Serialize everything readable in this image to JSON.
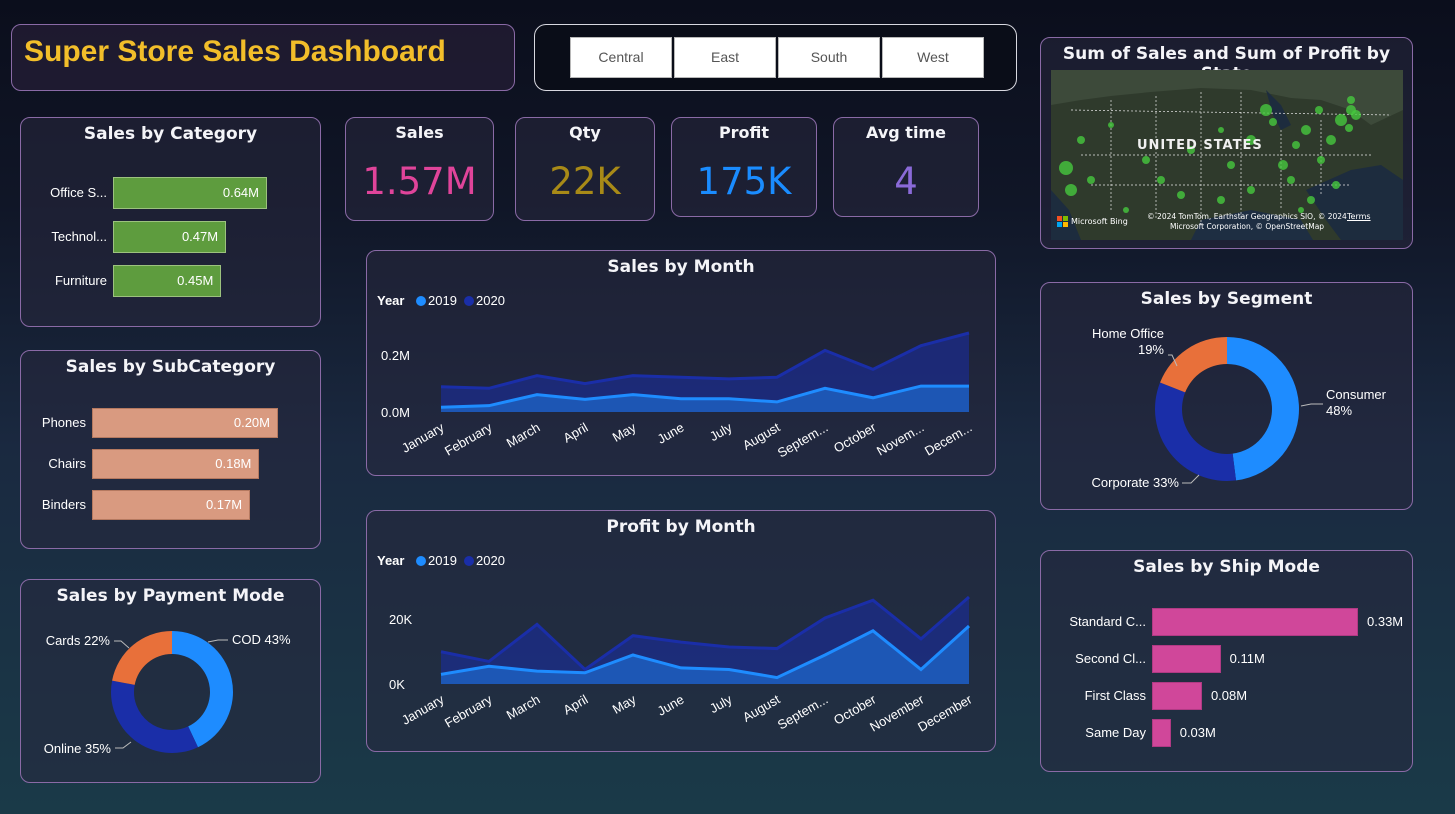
{
  "header": {
    "title": "Super Store Sales Dashboard"
  },
  "slicers": [
    "Central",
    "East",
    "South",
    "West"
  ],
  "kpis": [
    {
      "label": "Sales",
      "value": "1.57M",
      "color": "#e0449a"
    },
    {
      "label": "Qty",
      "value": "22K",
      "color": "#a88a17"
    },
    {
      "label": "Profit",
      "value": "175K",
      "color": "#1a8cff"
    },
    {
      "label": "Avg time",
      "value": "4",
      "color": "#8a6ad8"
    }
  ],
  "map": {
    "title": "Sum of Sales and Sum of Profit by State",
    "country_label": "UNITED STATES",
    "logo_text": "Microsoft Bing",
    "attribution": "© 2024 TomTom, Earthstar Geographics SIO, © 2024 Microsoft Corporation, © OpenStreetMap",
    "terms": "Terms"
  },
  "chart_data": [
    {
      "id": "sales_by_category",
      "type": "bar",
      "orientation": "horizontal",
      "title": "Sales by Category",
      "categories": [
        "Office S...",
        "Technol...",
        "Furniture"
      ],
      "values": [
        0.64,
        0.47,
        0.45
      ],
      "labels": [
        "0.64M",
        "0.47M",
        "0.45M"
      ],
      "color": "#5e9c3e"
    },
    {
      "id": "sales_by_subcategory",
      "type": "bar",
      "orientation": "horizontal",
      "title": "Sales by SubCategory",
      "categories": [
        "Phones",
        "Chairs",
        "Binders"
      ],
      "values": [
        0.2,
        0.18,
        0.17
      ],
      "labels": [
        "0.20M",
        "0.18M",
        "0.17M"
      ],
      "color": "#d99a80"
    },
    {
      "id": "sales_by_payment_mode",
      "type": "pie",
      "donut": true,
      "title": "Sales by Payment Mode",
      "slices": [
        {
          "name": "COD",
          "value": 43,
          "label": "COD 43%",
          "color": "#1e8cff"
        },
        {
          "name": "Online",
          "value": 35,
          "label": "Online 35%",
          "color": "#1a2ea8"
        },
        {
          "name": "Cards",
          "value": 22,
          "label": "Cards 22%",
          "color": "#e8703a"
        }
      ]
    },
    {
      "id": "sales_by_month",
      "type": "area",
      "title": "Sales by Month",
      "legend_title": "Year",
      "legend_position": "top-left",
      "x": [
        "January",
        "February",
        "March",
        "April",
        "May",
        "June",
        "July",
        "August",
        "Septem...",
        "October",
        "Novem...",
        "Decem..."
      ],
      "series": [
        {
          "name": "2019",
          "color": "#1e8cff",
          "values": [
            0.015,
            0.02,
            0.055,
            0.04,
            0.055,
            0.042,
            0.042,
            0.032,
            0.075,
            0.045,
            0.082,
            0.082
          ]
        },
        {
          "name": "2020",
          "color": "#1a2ea8",
          "values": [
            0.08,
            0.075,
            0.115,
            0.09,
            0.115,
            0.11,
            0.105,
            0.11,
            0.195,
            0.135,
            0.21,
            0.25
          ]
        }
      ],
      "y_ticks": [
        "0.0M",
        "0.2M"
      ],
      "ylim": [
        0,
        0.25
      ]
    },
    {
      "id": "profit_by_month",
      "type": "area",
      "title": "Profit by Month",
      "legend_title": "Year",
      "legend_position": "top-left",
      "x": [
        "January",
        "February",
        "March",
        "April",
        "May",
        "June",
        "July",
        "August",
        "Septem...",
        "October",
        "November",
        "December"
      ],
      "series": [
        {
          "name": "2019",
          "color": "#1e8cff",
          "values": [
            3000,
            5500,
            4000,
            3500,
            9000,
            5000,
            4500,
            2000,
            9000,
            16500,
            4500,
            18000
          ]
        },
        {
          "name": "2020",
          "color": "#1a2ea8",
          "values": [
            10000,
            7000,
            18500,
            4500,
            15000,
            13000,
            11500,
            11000,
            20500,
            26000,
            14000,
            27000
          ]
        }
      ],
      "y_ticks": [
        "0K",
        "20K"
      ],
      "ylim": [
        0,
        27000
      ]
    },
    {
      "id": "sales_by_segment",
      "type": "pie",
      "donut": true,
      "title": "Sales by Segment",
      "slices": [
        {
          "name": "Consumer",
          "value": 48,
          "label": "Consumer 48%",
          "color": "#1e8cff"
        },
        {
          "name": "Corporate",
          "value": 33,
          "label": "Corporate 33%",
          "color": "#1a2ea8"
        },
        {
          "name": "Home Office",
          "value": 19,
          "label": "Home Office 19%",
          "color": "#e8703a"
        }
      ]
    },
    {
      "id": "sales_by_ship_mode",
      "type": "bar",
      "orientation": "horizontal",
      "title": "Sales by Ship Mode",
      "categories": [
        "Standard C...",
        "Second Cl...",
        "First Class",
        "Same Day"
      ],
      "values": [
        0.33,
        0.11,
        0.08,
        0.03
      ],
      "labels": [
        "0.33M",
        "0.11M",
        "0.08M",
        "0.03M"
      ],
      "color": "#d0479a"
    }
  ]
}
